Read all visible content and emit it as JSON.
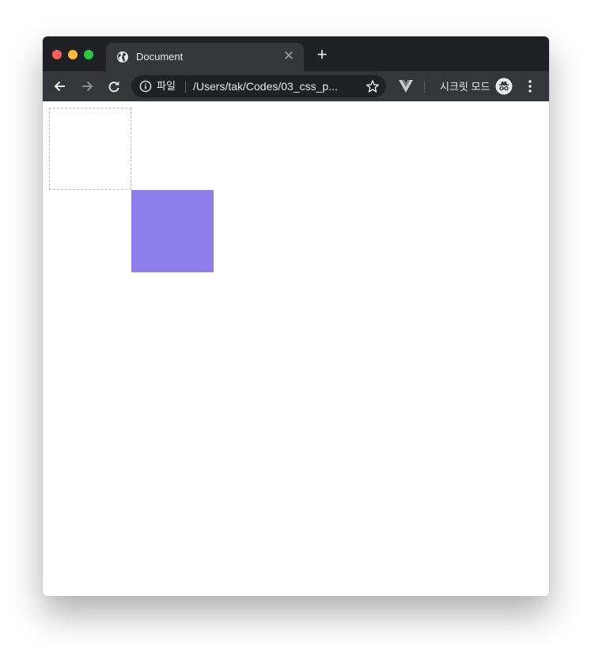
{
  "colors": {
    "chrome_dark": "#202124",
    "toolbar": "#35363a",
    "box_fill": "#8e7eea",
    "box_outline": "#b9b4e8",
    "traffic_close": "#fe5f57",
    "traffic_minimize": "#febc2e",
    "traffic_maximize": "#28c840"
  },
  "tab": {
    "title": "Document",
    "icon": "globe-icon",
    "close_icon": "close-icon"
  },
  "new_tab_icon": "plus-icon",
  "toolbar": {
    "back_icon": "arrow-left-icon",
    "forward_icon": "arrow-right-icon",
    "reload_icon": "reload-icon",
    "info_icon": "info-icon",
    "scheme_label": "파일",
    "url": "/Users/tak/Codes/03_css_p...",
    "bookmark_icon": "star-icon",
    "extension_icon": "vue-devtools-icon",
    "incognito_label": "시크릿 모드",
    "incognito_icon": "incognito-icon",
    "menu_icon": "more-vert-icon"
  }
}
